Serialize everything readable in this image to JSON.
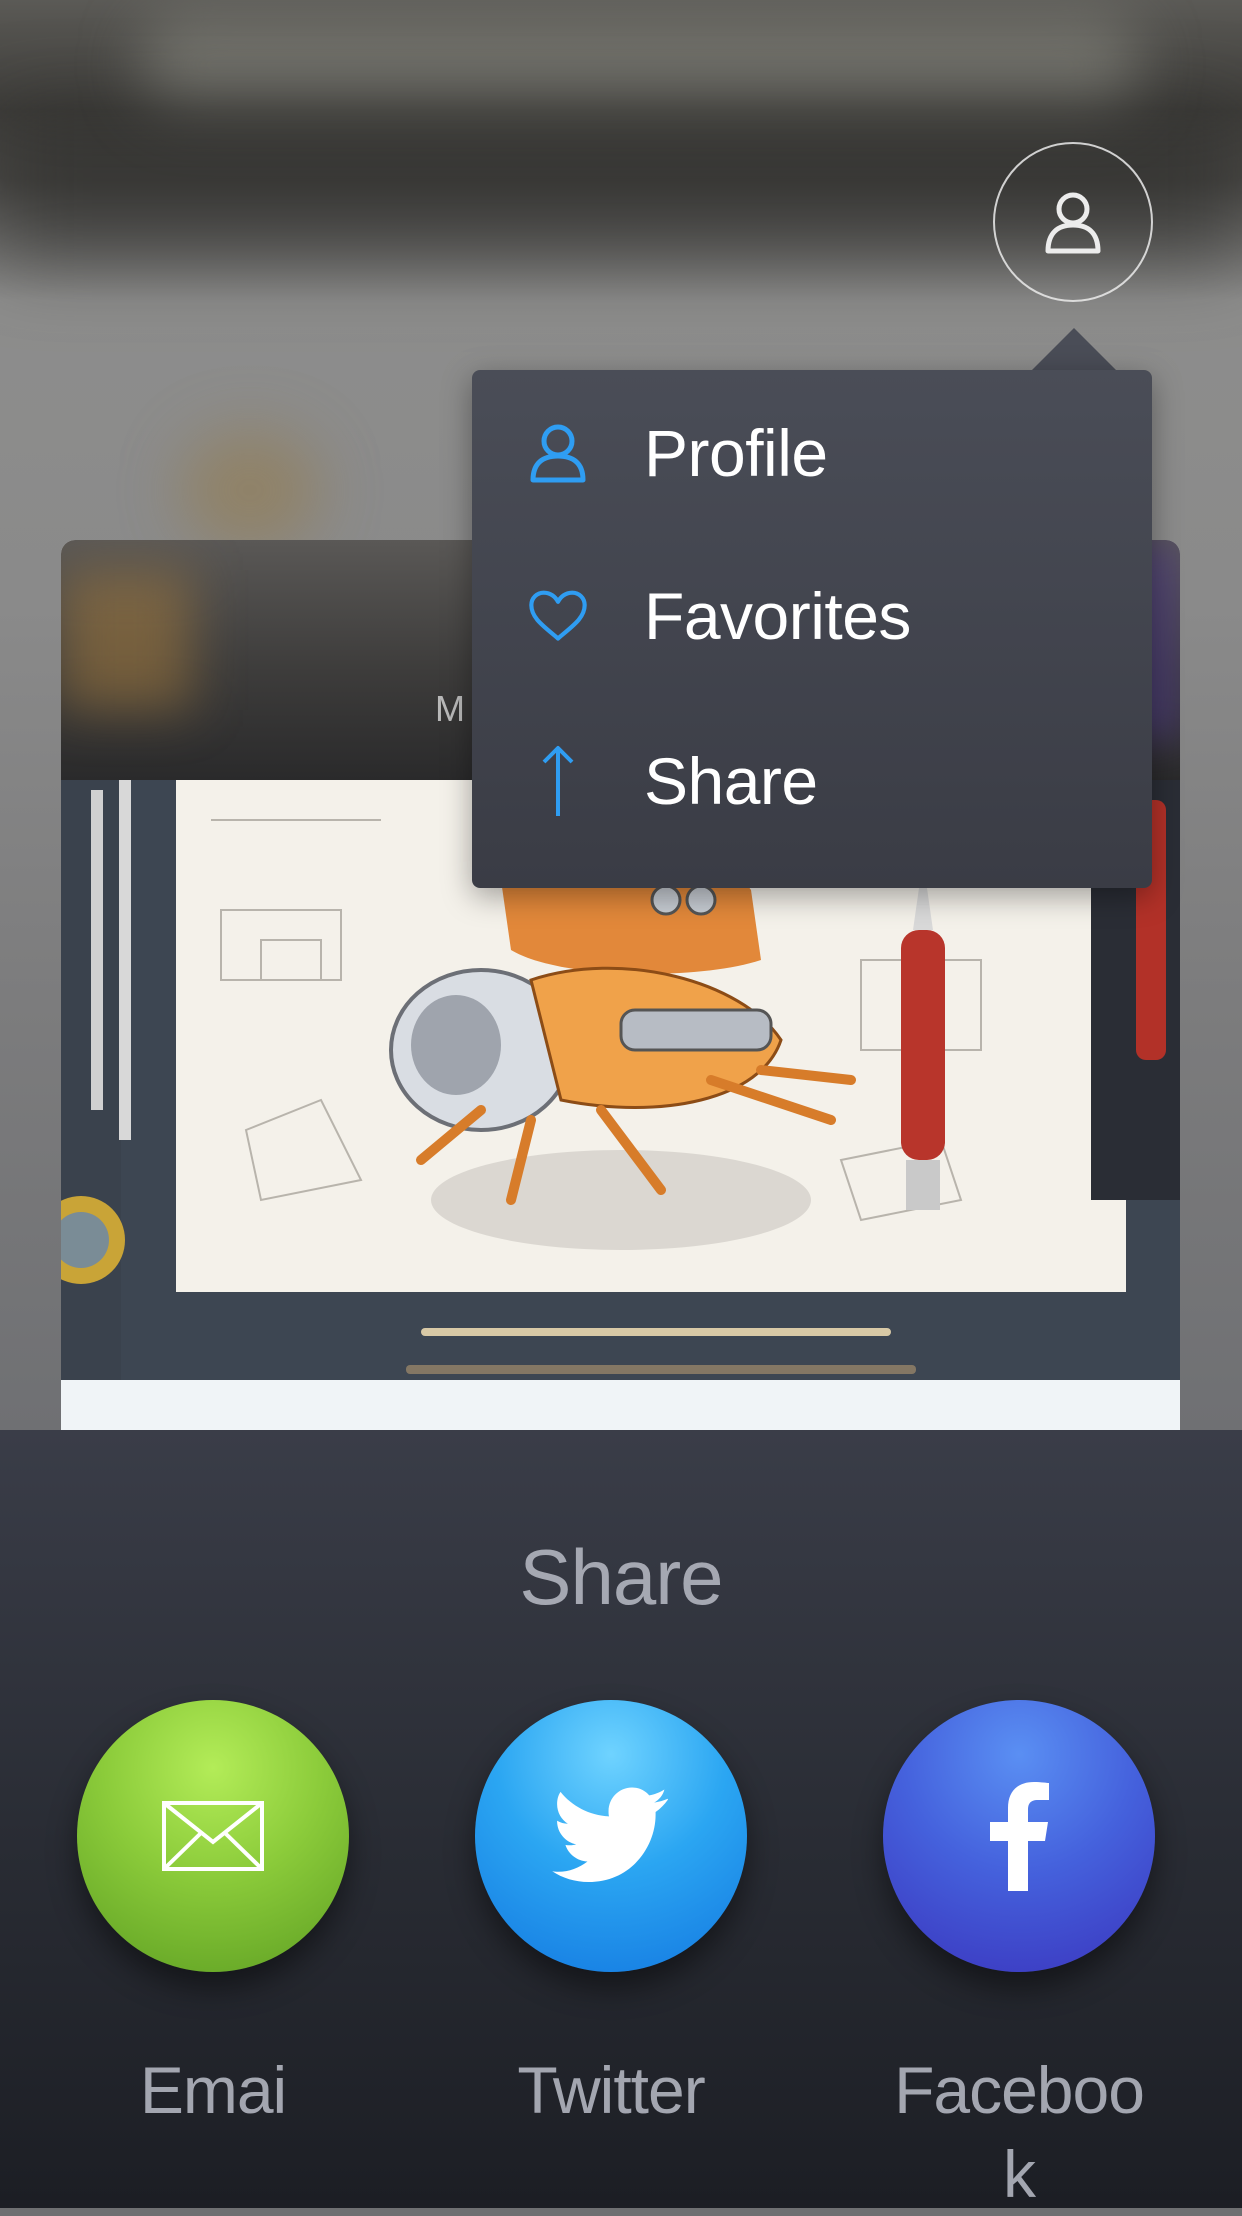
{
  "background": {
    "card_header_text": "M"
  },
  "profile_button": {
    "icon": "user-icon"
  },
  "dropdown_menu": {
    "items": [
      {
        "label": "Profile",
        "icon": "user-icon",
        "color": "#2f9df2"
      },
      {
        "label": "Favorites",
        "icon": "heart-icon",
        "color": "#2f9df2"
      },
      {
        "label": "Share",
        "icon": "arrow-up-icon",
        "color": "#2f9df2"
      }
    ]
  },
  "share_sheet": {
    "title": "Share",
    "buttons": [
      {
        "label": "Emai",
        "icon": "envelope-icon",
        "color": "#8bcb3a"
      },
      {
        "label": "Twitter",
        "icon": "twitter-bird-icon",
        "color": "#2ba6f2"
      },
      {
        "label": "Faceboo\nk",
        "icon": "facebook-icon",
        "color": "#4562dd"
      }
    ]
  }
}
